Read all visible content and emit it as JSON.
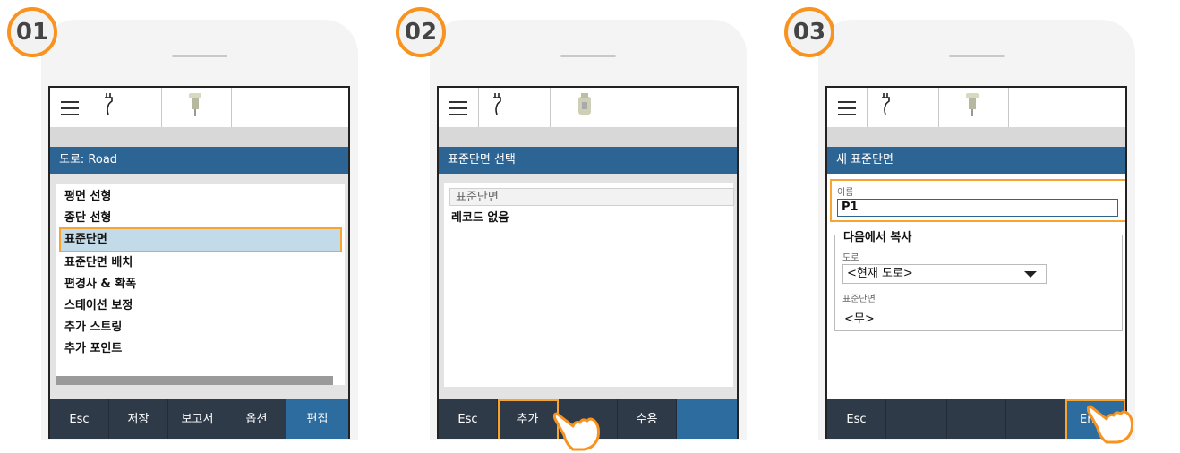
{
  "panels": [
    {
      "step": "01",
      "title": "도로: Road",
      "items": [
        "평면 선형",
        "종단 선형",
        "표준단면",
        "표준단면 배치",
        "편경사 & 확폭",
        "스테이션 보정",
        "추가 스트링",
        "추가 포인트"
      ],
      "selected_index": 2,
      "buttons": [
        "Esc",
        "저장",
        "보고서",
        "옵션",
        "편집"
      ]
    },
    {
      "step": "02",
      "title": "표준단면 선택",
      "list_header": "표준단면",
      "empty_text": "레코드 없음",
      "buttons": [
        "Esc",
        "추가",
        "",
        "수용",
        ""
      ]
    },
    {
      "step": "03",
      "title": "새 표준단면",
      "name_label": "이름",
      "name_value": "P1",
      "group_title": "다음에서 복사",
      "road_label": "도로",
      "road_value": "<현재 도로>",
      "template_label": "표준단면",
      "template_value": "<무>",
      "buttons": [
        "Esc",
        "",
        "",
        "",
        "Enter"
      ]
    }
  ],
  "colors": {
    "accent": "#f7931e",
    "titlebar": "#2c6494",
    "bottombar": "#2f3a48",
    "selection": "#c3dbe8"
  },
  "icons": [
    "menu-icon",
    "plug-icon",
    "receiver-icon",
    "pointing-hand-icon",
    "dropdown-caret-icon"
  ]
}
